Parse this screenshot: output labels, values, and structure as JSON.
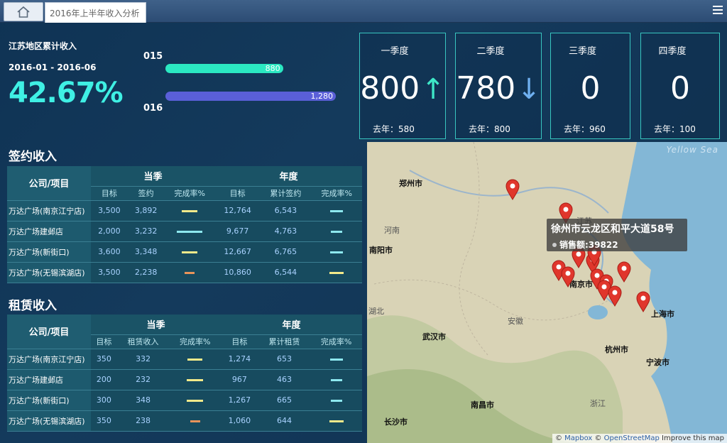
{
  "topbar": {
    "tab_title": "2016年上半年收入分析"
  },
  "summary": {
    "region_label": "江苏地区累计收入",
    "date_range": "2016-01 - 2016-06",
    "percent": "42.67%",
    "bars": [
      {
        "year": "015",
        "value": "880",
        "fraction": 0.69,
        "color": "#2be8c2"
      },
      {
        "year": "016",
        "value": "1,280",
        "fraction": 1.0,
        "color": "#5a5fd8"
      }
    ]
  },
  "quarters": [
    {
      "title": "一季度",
      "value": "800",
      "arrow": "↑",
      "arrow_color": "#3ee8c8",
      "last_year": "去年：580"
    },
    {
      "title": "二季度",
      "value": "780",
      "arrow": "↓",
      "arrow_color": "#6fb0f0",
      "last_year": "去年：800"
    },
    {
      "title": "三季度",
      "value": "0",
      "arrow": "",
      "arrow_color": "",
      "last_year": "去年：960"
    },
    {
      "title": "四季度",
      "value": "0",
      "arrow": "",
      "arrow_color": "",
      "last_year": "去年：100"
    }
  ],
  "sign_table": {
    "section_title": "签约收入",
    "corner": "公司/项目",
    "group1": "当季",
    "group2": "年度",
    "cols": [
      "目标",
      "签约",
      "完成率%",
      "目标",
      "累计签约",
      "完成率%"
    ],
    "rows": [
      {
        "name": "万达广场(南京江宁店)",
        "c1": "3,500",
        "c2": "3,892",
        "r1": "#f2e98a",
        "r1w": 0.6,
        "c3": "12,764",
        "c4": "6,543",
        "r2": "#8ee8ef",
        "r2w": 0.5
      },
      {
        "name": "万达广场建邺店",
        "c1": "2,000",
        "c2": "3,232",
        "r1": "#8ee8ef",
        "r1w": 1.0,
        "c3": "9,677",
        "c4": "4,763",
        "r2": "#8ee8ef",
        "r2w": 0.45
      },
      {
        "name": "万达广场(新街口)",
        "c1": "3,600",
        "c2": "3,348",
        "r1": "#f2e98a",
        "r1w": 0.6,
        "c3": "12,667",
        "c4": "6,765",
        "r2": "#8ee8ef",
        "r2w": 0.5
      },
      {
        "name": "万达广场(无锡滨湖店)",
        "c1": "3,500",
        "c2": "2,238",
        "r1": "#e8935a",
        "r1w": 0.4,
        "c3": "10,860",
        "c4": "6,544",
        "r2": "#f2e98a",
        "r2w": 0.55
      }
    ]
  },
  "rent_table": {
    "section_title": "租赁收入",
    "corner": "公司/项目",
    "group1": "当季",
    "group2": "年度",
    "cols": [
      "目标",
      "租赁收入",
      "完成率%",
      "目标",
      "累计租赁",
      "完成率%"
    ],
    "rows": [
      {
        "name": "万达广场(南京江宁店)",
        "c1": "350",
        "c2": "332",
        "r1": "#f2e98a",
        "r1w": 0.6,
        "c3": "1,274",
        "c4": "653",
        "r2": "#8ee8ef",
        "r2w": 0.5
      },
      {
        "name": "万达广场建邺店",
        "c1": "200",
        "c2": "232",
        "r1": "#f2e98a",
        "r1w": 0.65,
        "c3": "967",
        "c4": "463",
        "r2": "#8ee8ef",
        "r2w": 0.45
      },
      {
        "name": "万达广场(新街口)",
        "c1": "300",
        "c2": "348",
        "r1": "#f2e98a",
        "r1w": 0.65,
        "c3": "1,267",
        "c4": "665",
        "r2": "#8ee8ef",
        "r2w": 0.45
      },
      {
        "name": "万达广场(无锡滨湖店)",
        "c1": "350",
        "c2": "238",
        "r1": "#e8935a",
        "r1w": 0.4,
        "c3": "1,060",
        "c4": "644",
        "r2": "#f2e98a",
        "r2w": 0.55
      }
    ]
  },
  "map": {
    "tooltip_address": "徐州市云龙区和平大道58号",
    "tooltip_sales": "销售额:39822",
    "labels": [
      "郑州市",
      "河南",
      "南阳市",
      "江苏",
      "安徽",
      "武汉市",
      "湖北",
      "南京市",
      "上海市",
      "杭州市",
      "宁波市",
      "南昌市",
      "浙江",
      "长沙市"
    ],
    "sea": "Yellow Sea",
    "attribution": {
      "prefix": "© ",
      "mapbox": "Mapbox",
      "mid": " © ",
      "osm": "OpenStreetMap",
      "improve": " Improve this map"
    }
  }
}
